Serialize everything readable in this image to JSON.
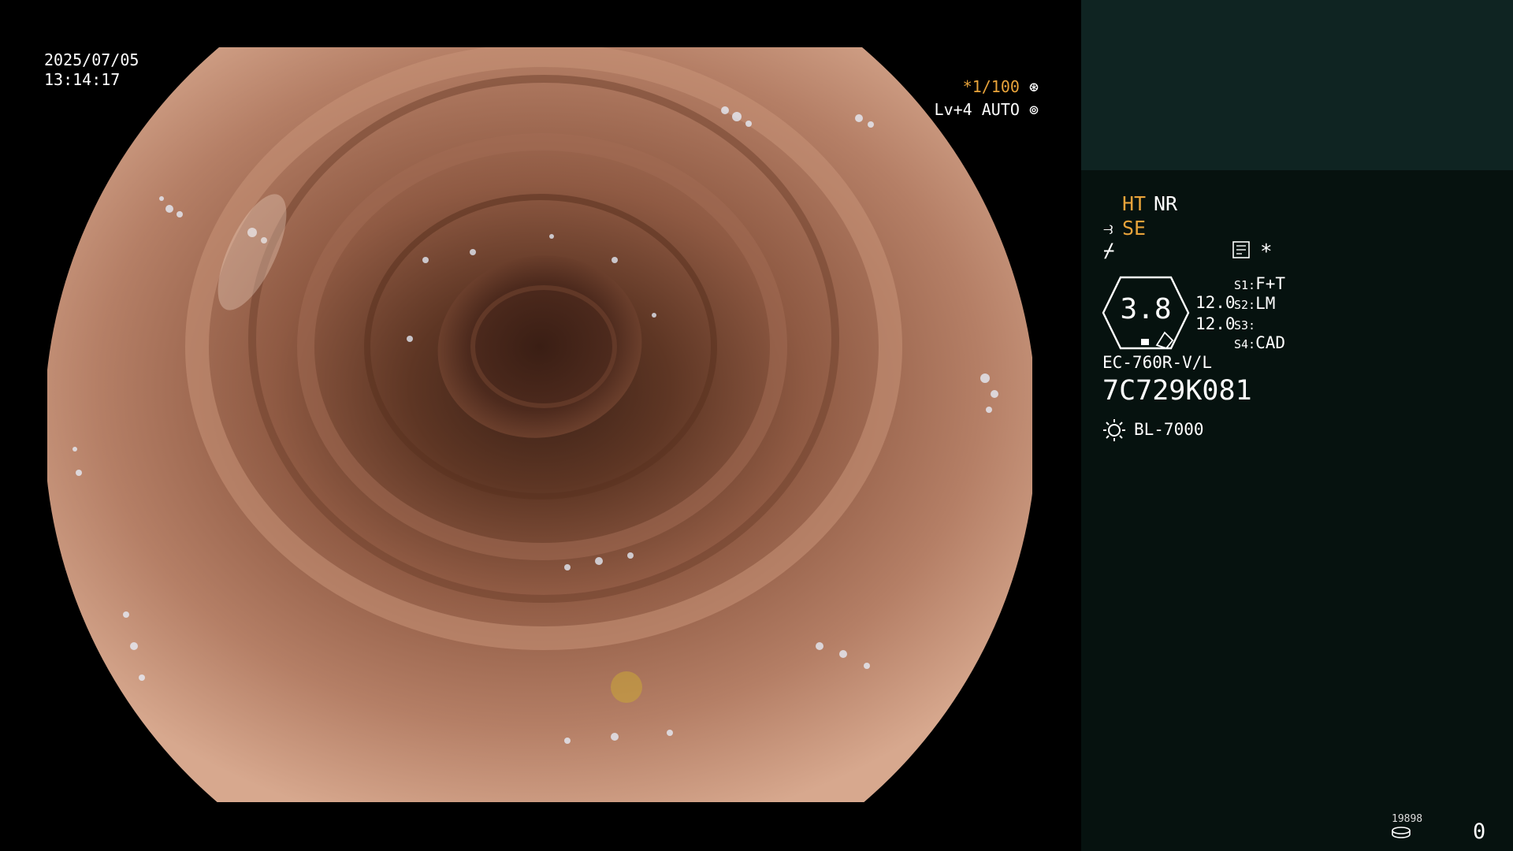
{
  "overlay": {
    "date": "2025/07/05",
    "time": "13:14:17",
    "shutter": "*1/100",
    "shutter_icon": "aperture-icon",
    "level": "Lv+4 AUTO",
    "level_icon": "iris-icon"
  },
  "panel": {
    "ht": "HT",
    "nr": "NR",
    "se": "SE",
    "se_icon": "scope-se-icon",
    "flash_icon": "flash-off-icon",
    "menu_icon": "menu-card-icon",
    "star": "*",
    "gauge_value": "3.8",
    "gauge_line1": "12.0",
    "gauge_line2": "12.0",
    "switches": [
      {
        "key": "S1:",
        "value": "F+T"
      },
      {
        "key": "S2:",
        "value": "LM"
      },
      {
        "key": "S3:",
        "value": ""
      },
      {
        "key": "S4:",
        "value": "CAD"
      }
    ],
    "scope_model": "EC-760R-V/L",
    "scope_serial": "7C729K081",
    "lamp_icon": "lamp-icon",
    "light_source": "BL-7000",
    "capture_small": "19898",
    "capture_count": "0"
  },
  "colors": {
    "amber": "#e8a33a",
    "panel_bg": "#06120f",
    "panel_top_bg": "#0f2422"
  }
}
